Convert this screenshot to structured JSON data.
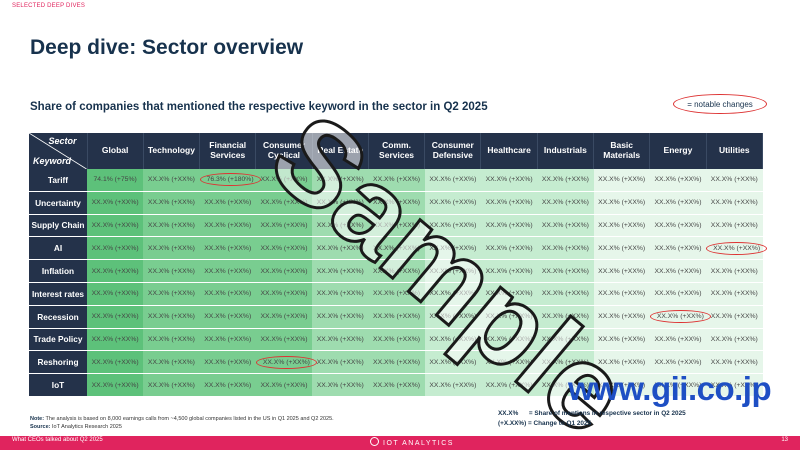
{
  "section_tag": "SELECTED DEEP DIVES",
  "title": "Deep dive: Sector overview",
  "subtitle": "Share of companies that mentioned the respective keyword in the sector in Q2 2025",
  "legend_label": "= notable changes",
  "table": {
    "corner_top": "Sector",
    "corner_bottom": "Keyword",
    "columns": [
      "Global",
      "Technology",
      "Financial Services",
      "Consumer Cyclical",
      "Real Estate",
      "Comm. Services",
      "Consumer Defensive",
      "Healthcare",
      "Industrials",
      "Basic Materials",
      "Energy",
      "Utilities"
    ],
    "rows": [
      {
        "keyword": "Tariff",
        "cells": [
          "74.1% (+75%)",
          "XX.X% (+XX%)",
          "76.3% (+180%)",
          "XX.X% (+XX%)",
          "XX.X% (+XX%)",
          "XX.X% (+XX%)",
          "XX.X% (+XX%)",
          "XX.X% (+XX%)",
          "XX.X% (+XX%)",
          "XX.X% (+XX%)",
          "XX.X% (+XX%)",
          "XX.X% (+XX%)"
        ]
      },
      {
        "keyword": "Uncertainty",
        "cells": [
          "XX.X% (+XX%)",
          "XX.X% (+XX%)",
          "XX.X% (+XX%)",
          "XX.X% (+XX%)",
          "XX.X% (+XX%)",
          "XX.X% (+XX%)",
          "XX.X% (+XX%)",
          "XX.X% (+XX%)",
          "XX.X% (+XX%)",
          "XX.X% (+XX%)",
          "XX.X% (+XX%)",
          "XX.X% (+XX%)"
        ]
      },
      {
        "keyword": "Supply Chain",
        "cells": [
          "XX.X% (+XX%)",
          "XX.X% (+XX%)",
          "XX.X% (+XX%)",
          "XX.X% (+XX%)",
          "XX.X% (+XX%)",
          "XX.X% (+XX%)",
          "XX.X% (+XX%)",
          "XX.X% (+XX%)",
          "XX.X% (+XX%)",
          "XX.X% (+XX%)",
          "XX.X% (+XX%)",
          "XX.X% (+XX%)"
        ]
      },
      {
        "keyword": "AI",
        "cells": [
          "XX.X% (+XX%)",
          "XX.X% (+XX%)",
          "XX.X% (+XX%)",
          "XX.X% (+XX%)",
          "XX.X% (+XX%)",
          "XX.X% (+XX%)",
          "XX.X% (+XX%)",
          "XX.X% (+XX%)",
          "XX.X% (+XX%)",
          "XX.X% (+XX%)",
          "XX.X% (+XX%)",
          "XX.X% (+XX%)"
        ]
      },
      {
        "keyword": "Inflation",
        "cells": [
          "XX.X% (+XX%)",
          "XX.X% (+XX%)",
          "XX.X% (+XX%)",
          "XX.X% (+XX%)",
          "XX.X% (+XX%)",
          "XX.X% (+XX%)",
          "XX.X% (+XX%)",
          "XX.X% (+XX%)",
          "XX.X% (+XX%)",
          "XX.X% (+XX%)",
          "XX.X% (+XX%)",
          "XX.X% (+XX%)"
        ]
      },
      {
        "keyword": "Interest rates",
        "cells": [
          "XX.X% (+XX%)",
          "XX.X% (+XX%)",
          "XX.X% (+XX%)",
          "XX.X% (+XX%)",
          "XX.X% (+XX%)",
          "XX.X% (+XX%)",
          "XX.X% (+XX%)",
          "XX.X% (+XX%)",
          "XX.X% (+XX%)",
          "XX.X% (+XX%)",
          "XX.X% (+XX%)",
          "XX.X% (+XX%)"
        ]
      },
      {
        "keyword": "Recession",
        "cells": [
          "XX.X% (+XX%)",
          "XX.X% (+XX%)",
          "XX.X% (+XX%)",
          "XX.X% (+XX%)",
          "XX.X% (+XX%)",
          "XX.X% (+XX%)",
          "XX.X% (+XX%)",
          "XX.X% (+XX%)",
          "XX.X% (+XX%)",
          "XX.X% (+XX%)",
          "XX.X% (+XX%)",
          "XX.X% (+XX%)"
        ]
      },
      {
        "keyword": "Trade Policy",
        "cells": [
          "XX.X% (+XX%)",
          "XX.X% (+XX%)",
          "XX.X% (+XX%)",
          "XX.X% (+XX%)",
          "XX.X% (+XX%)",
          "XX.X% (+XX%)",
          "XX.X% (+XX%)",
          "XX.X% (+XX%)",
          "XX.X% (+XX%)",
          "XX.X% (+XX%)",
          "XX.X% (+XX%)",
          "XX.X% (+XX%)"
        ]
      },
      {
        "keyword": "Reshoring",
        "cells": [
          "XX.X% (+XX%)",
          "XX.X% (+XX%)",
          "XX.X% (+XX%)",
          "XX.X% (+XX%)",
          "XX.X% (+XX%)",
          "XX.X% (+XX%)",
          "XX.X% (+XX%)",
          "XX.X% (+XX%)",
          "XX.X% (+XX%)",
          "XX.X% (+XX%)",
          "XX.X% (+XX%)",
          "XX.X% (+XX%)"
        ]
      },
      {
        "keyword": "IoT",
        "cells": [
          "XX.X% (+XX%)",
          "XX.X% (+XX%)",
          "XX.X% (+XX%)",
          "XX.X% (+XX%)",
          "XX.X% (+XX%)",
          "XX.X% (+XX%)",
          "XX.X% (+XX%)",
          "XX.X% (+XX%)",
          "XX.X% (+XX%)",
          "XX.X% (+XX%)",
          "XX.X% (+XX%)",
          "XX.X% (+XX%)"
        ]
      }
    ]
  },
  "note": {
    "note_label": "Note:",
    "note_text": "The analysis is based on 8,000 earnings calls from ~4,500 global companies listed in the US in Q1 2025 and Q2 2025.",
    "source_label": "Source:",
    "source_text": "IoT Analytics Research 2025"
  },
  "key": {
    "line1": "XX.X%      = Share of mentions in respective sector in Q2 2025",
    "line2": "(+X.XX%) = Change to Q1 2025"
  },
  "watermark_url": "www.gii.co.jp",
  "watermark_sample": "Sample",
  "footer": {
    "left": "What CEOs talked about Q2 2025",
    "brand": "IOT ANALYTICS",
    "page": "13"
  },
  "colors": {
    "header_bg": "#24324a",
    "accent": "#e0245e",
    "highlight_ring": "#dd3333",
    "shade_levels": [
      "#5dc17a",
      "#79cd90",
      "#9edcaf",
      "#c5ecd0",
      "#e6f6ea"
    ]
  },
  "highlights": [
    {
      "row": 0,
      "col": 2
    },
    {
      "row": 3,
      "col": 11
    },
    {
      "row": 6,
      "col": 10
    },
    {
      "row": 8,
      "col": 3
    }
  ]
}
